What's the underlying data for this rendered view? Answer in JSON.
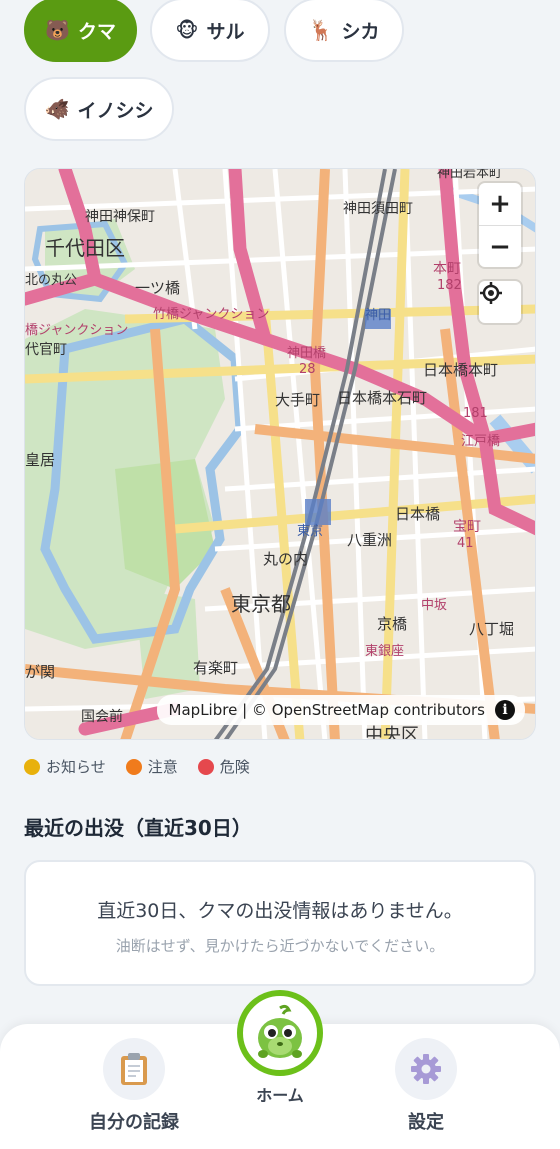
{
  "filters": [
    {
      "label": "クマ",
      "emoji": "🐻",
      "active": true
    },
    {
      "label": "サル",
      "emoji": "🐵",
      "active": false
    },
    {
      "label": "シカ",
      "emoji": "🦌",
      "active": false
    },
    {
      "label": "イノシシ",
      "emoji": "🐗",
      "active": false
    }
  ],
  "map": {
    "zoom_in": "+",
    "zoom_out": "−",
    "attribution_maplibre": "MapLibre",
    "attribution_sep": " | © ",
    "attribution_osm": "OpenStreetMap",
    "attribution_contrib": "contributors",
    "info": "i",
    "labels": {
      "l1": "神田神保町",
      "l2": "神田須田町",
      "l3": "千代田区",
      "l4": "北の丸公",
      "l5": "一ツ橋",
      "l6": "竹橋ジャンクション",
      "l7": "神田橋",
      "l8": "代官町",
      "l9": "大手町",
      "l10": "日本橋本石町",
      "l11": "日本橋本町",
      "l12": "皇居",
      "l13": "日本橋",
      "l14": "八重洲",
      "l15": "丸の内",
      "l16": "東京都",
      "l17": "京橋",
      "l18": "八丁堀",
      "l19": "有楽町",
      "l20": "が関",
      "l21": "中央区",
      "l22": "本町",
      "l23": "江戸橋",
      "l24": "宝町",
      "l25": "東京",
      "l26": "東銀座",
      "l27": "橋ジャンクション",
      "l28": "神田",
      "l29": "中坂",
      "l30": "182",
      "l31": "181",
      "l32": "28",
      "l33": "41",
      "l34": "神田岩本町",
      "l35": "国会前"
    }
  },
  "legend": [
    {
      "label": "お知らせ",
      "color": "#e8b10c"
    },
    {
      "label": "注意",
      "color": "#f07b1c"
    },
    {
      "label": "危険",
      "color": "#e5484d"
    }
  ],
  "recent": {
    "title": "最近の出没（直近30日）",
    "empty_main": "直近30日、クマの出没情報はありません。",
    "empty_sub": "油断はせず、見かけたら近づかないでください。"
  },
  "nav": {
    "records": "自分の記録",
    "home": "ホーム",
    "settings": "設定"
  }
}
